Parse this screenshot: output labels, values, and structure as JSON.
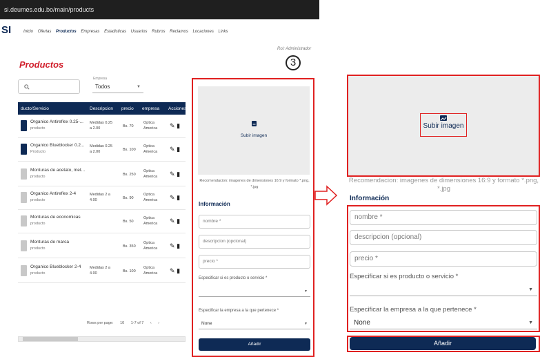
{
  "browser": {
    "url": "si.deumes.edu.bo/main/products"
  },
  "app": {
    "logo": "SI",
    "nav": [
      "Inicio",
      "Ofertas",
      "Productos",
      "Empresas",
      "Estadisticas",
      "Usuarios",
      "Rubros",
      "Reclamos",
      "Locaciones",
      "Links"
    ],
    "nav_active": "Productos",
    "role": "Rol: Administrador",
    "page_title": "Productos",
    "step_number": "3"
  },
  "filters": {
    "search_icon": "search-icon",
    "empresa_label": "Empresa",
    "empresa_value": "Todos"
  },
  "table": {
    "headers": [
      "ducto/Servicio",
      "Descripcion",
      "precio",
      "empresa",
      "Acciones"
    ],
    "rows": [
      {
        "name": "Organico Antireflex 0.25-...",
        "category": "producto",
        "description": "Medidas 0.25 a 2.00",
        "price": "Bs. 70",
        "company": "Optica America",
        "thumb": "#0e2a55"
      },
      {
        "name": "Organico Blueblocker 0.2...",
        "category": "Producto",
        "description": "Medidas 0.25 a 2.00",
        "price": "Bs. 100",
        "company": "Optica America",
        "thumb": "#0e2a55"
      },
      {
        "name": "Monturas de acetato, met...",
        "category": "producto",
        "description": "",
        "price": "Bs. 250",
        "company": "Optica America",
        "thumb": "#c8c8c8"
      },
      {
        "name": "Organico Antireflex 2-4",
        "category": "producto",
        "description": "Medidas 2 a 4.00",
        "price": "Bs. 90",
        "company": "Optica America",
        "thumb": "#c8c8c8"
      },
      {
        "name": "Monturas de economicas",
        "category": "producto",
        "description": "",
        "price": "Bs. 50",
        "company": "Optica America",
        "thumb": "#c8c8c8"
      },
      {
        "name": "Monturas de marca",
        "category": "producto",
        "description": "",
        "price": "Bs. 350",
        "company": "Optica America",
        "thumb": "#c8c8c8"
      },
      {
        "name": "Organico Blueblocker 2-4",
        "category": "producto",
        "description": "Medidas 2 a 4.00",
        "price": "Bs. 100",
        "company": "Optica America",
        "thumb": "#c8c8c8"
      }
    ],
    "edit_icon": "pencil-icon",
    "delete_icon": "trash-icon"
  },
  "pagination": {
    "rows_per_page_label": "Rows per page:",
    "rows_per_page": "10",
    "range": "1-7 of 7",
    "prev": "‹",
    "next": "›"
  },
  "form_small": {
    "upload_label": "Subir imagen",
    "recommendation": "Recomendacion: imagenes de dimensiones 16:9 y formato *.png, *.jpg",
    "info_title": "Información",
    "name_placeholder": "nombre *",
    "description_placeholder": "descripcion (opcional)",
    "price_placeholder": "precio *",
    "type_label": "Especificar si es producto o servicio *",
    "type_value": "",
    "company_label": "Especificar la empresa a la que pertenece *",
    "company_value": "None",
    "submit": "Añadir"
  },
  "form_zoom": {
    "upload_label": "Subir imagen",
    "recommendation": "Recomendacion: imagenes de dimensiones 16:9 y formato *.png, *.jpg",
    "info_title": "Información",
    "name_placeholder": "nombre *",
    "description_placeholder": "descripcion (opcional)",
    "price_placeholder": "precio *",
    "type_label": "Especificar si es producto o servicio *",
    "type_value": "",
    "company_label": "Especificar la empresa a la que pertenece *",
    "company_value": "None",
    "submit": "Añadir"
  },
  "colors": {
    "primary": "#0e2a55",
    "highlight": "#e02020",
    "title": "#d11e2b"
  }
}
